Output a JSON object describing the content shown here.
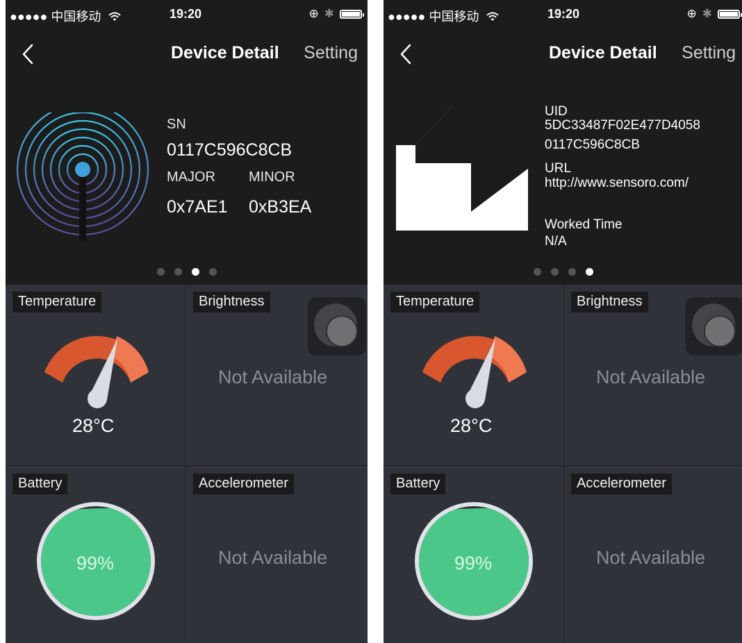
{
  "colors": {
    "background": "#1c1c1c",
    "tile_background": "#30323a",
    "gauge_orange": "#d9572f",
    "battery_green": "#4bc889",
    "beacon_blue": "#3aa9d8"
  },
  "status_bar": {
    "signal_carrier": "●●●●● 中国移动",
    "wifi_icon": "wifi-icon",
    "time": "19:20",
    "icons": [
      "rotation-lock-icon",
      "bluetooth-icon",
      "battery-icon"
    ]
  },
  "nav": {
    "back_icon": "chevron-left-icon",
    "title": "Device Detail",
    "setting": "Setting"
  },
  "left_screen": {
    "header": {
      "icon": "beacon-icon",
      "sn_label": "SN",
      "sn_value": "0117C596C8CB",
      "major_label": "MAJOR",
      "minor_label": "MINOR",
      "major_value": "0x7AE1",
      "minor_value": "0xB3EA"
    },
    "page_dots": {
      "count": 4,
      "active_index": 2
    }
  },
  "right_screen": {
    "header": {
      "icon": "sensoro-logo-icon",
      "uid_label": "UID",
      "uid_line1": "5DC33487F02E477D4058",
      "uid_line2": "0117C596C8CB",
      "url_label": "URL",
      "url_value": "http://www.sensoro.com/",
      "worked_time_label": "Worked Time",
      "worked_time_value": "N/A"
    },
    "page_dots": {
      "count": 4,
      "active_index": 3
    }
  },
  "tiles": {
    "temperature": {
      "label": "Temperature",
      "value": "28°C",
      "icon": "thermometer-gauge-icon"
    },
    "brightness": {
      "label": "Brightness",
      "status": "Not Available",
      "button_icon": "circle-button-icon"
    },
    "battery": {
      "label": "Battery",
      "value": "99%",
      "level": 0.99,
      "icon": "battery-level-icon"
    },
    "accelerometer": {
      "label": "Accelerometer",
      "status": "Not Available"
    }
  }
}
